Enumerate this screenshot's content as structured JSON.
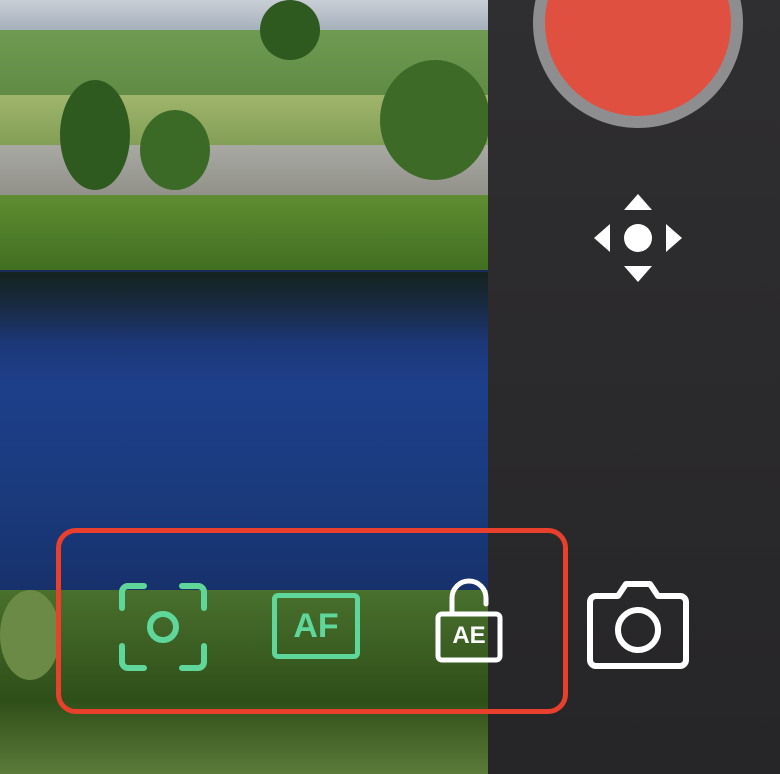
{
  "controls": {
    "af_label": "AF",
    "ae_label": "AE"
  },
  "icons": {
    "record": "record-icon",
    "move": "move-arrows-icon",
    "focus_frame": "focus-frame-icon",
    "ae_lock": "unlocked-padlock-icon",
    "camera": "camera-icon"
  },
  "colors": {
    "record_red": "#e05040",
    "accent_green": "#5fd79a",
    "highlight_red": "#e8402c",
    "panel_bg": "#2a2a2c"
  }
}
